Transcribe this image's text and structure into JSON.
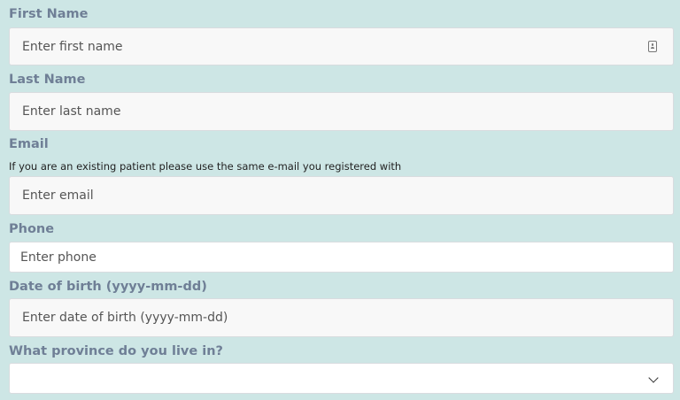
{
  "form": {
    "first_name": {
      "label": "First Name",
      "placeholder": "Enter first name",
      "icon": "contact-card-icon"
    },
    "last_name": {
      "label": "Last Name",
      "placeholder": "Enter last name"
    },
    "email": {
      "label": "Email",
      "help": "If you are an existing patient please use the same e-mail you registered with",
      "placeholder": "Enter email"
    },
    "phone": {
      "label": "Phone",
      "placeholder": "Enter phone"
    },
    "dob": {
      "label": "Date of birth (yyyy-mm-dd)",
      "placeholder": "Enter date of birth (yyyy-mm-dd)"
    },
    "province": {
      "label": "What province do you live in?",
      "selected": "",
      "icon": "chevron-down-icon"
    }
  },
  "colors": {
    "background": "#cde6e5",
    "label": "#6f7f96",
    "field": "#f8f8f8"
  }
}
